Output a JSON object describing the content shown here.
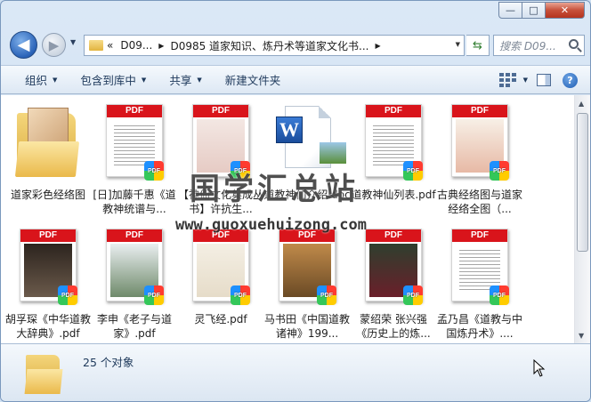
{
  "window": {
    "caption": {
      "minimize": "—",
      "maximize": "□",
      "close": "✕"
    }
  },
  "nav": {
    "back_icon": "◀",
    "forward_icon": "▶",
    "address": {
      "seg1": "D09...",
      "seg2": "D0985 道家知识、炼丹术等道家文化书...",
      "prefix": "«"
    },
    "search_placeholder": "搜索 D09..."
  },
  "toolbar": {
    "organize": "组织",
    "include_library": "包含到库中",
    "share": "共享",
    "new_folder": "新建文件夹"
  },
  "files": [
    {
      "label": "道家彩色经络图",
      "type": "folder"
    },
    {
      "label": "[日]加藤千惠《道教神统谱与...",
      "type": "pdf"
    },
    {
      "label": "【神仙文化集成丛书】许抗生...",
      "type": "pdf"
    },
    {
      "label": "道教神仙介绍.doc",
      "type": "doc"
    },
    {
      "label": "道教神仙列表.pdf",
      "type": "pdf"
    },
    {
      "label": "古典经络图与道家经络全图（...",
      "type": "pdf"
    },
    {
      "label": "胡孚琛《中华道教大辞典》.pdf",
      "type": "pdf"
    },
    {
      "label": "李申《老子与道家》.pdf",
      "type": "pdf"
    },
    {
      "label": "灵飞经.pdf",
      "type": "pdf"
    },
    {
      "label": "马书田《中国道教诸神》199...",
      "type": "pdf"
    },
    {
      "label": "蒙绍荣 张兴强《历史上的炼...",
      "type": "pdf"
    },
    {
      "label": "孟乃昌《道教与中国炼丹术》....",
      "type": "pdf"
    }
  ],
  "pdf_bar_label": "PDF",
  "badge_label": "PDF",
  "word_logo": "W",
  "watermark": {
    "line1": "国学汇总站",
    "line2": "www.guoxuehuizong.com"
  },
  "details": {
    "count": "25 个对象"
  },
  "colors": {
    "pdf_red": "#d9141b",
    "accent": "#1e395b"
  }
}
